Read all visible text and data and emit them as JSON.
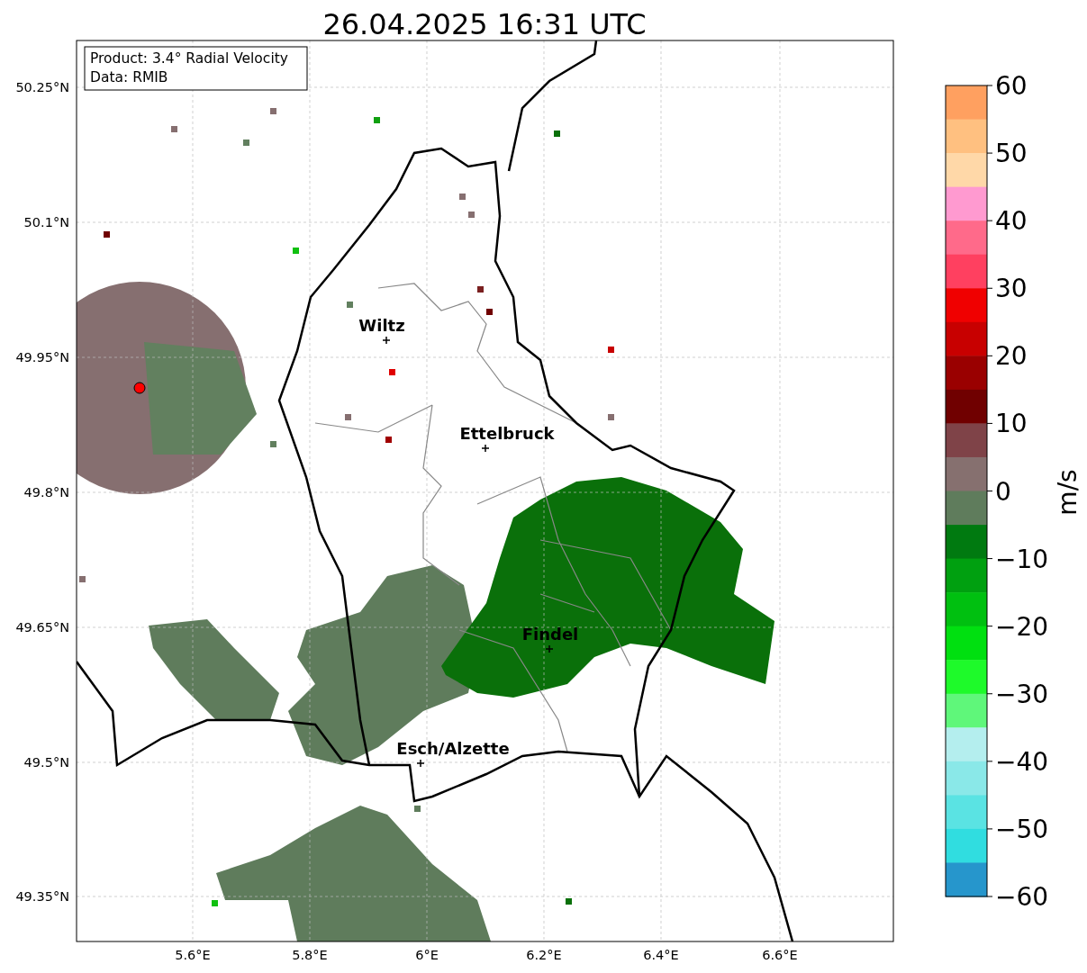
{
  "title": "26.04.2025 16:31 UTC",
  "info_box": [
    "Product: 3.4° Radial Velocity",
    "Data: RMIB"
  ],
  "cities": [
    {
      "name": "Wiltz"
    },
    {
      "name": "Ettelbruck"
    },
    {
      "name": "Findel"
    },
    {
      "name": "Esch/Alzette"
    }
  ],
  "y_axis_labels": [
    "50.25°N",
    "50.1°N",
    "49.95°N",
    "49.8°N",
    "49.65°N",
    "49.5°N",
    "49.35°N"
  ],
  "x_axis_labels": [
    "5.6°E",
    "5.8°E",
    "6°E",
    "6.2°E",
    "6.4°E",
    "6.6°E"
  ],
  "colorbar": {
    "label": "m/s",
    "ticks": [
      "60",
      "50",
      "40",
      "30",
      "20",
      "10",
      "0",
      "−10",
      "−20",
      "−30",
      "−40",
      "−50",
      "−60"
    ]
  }
}
